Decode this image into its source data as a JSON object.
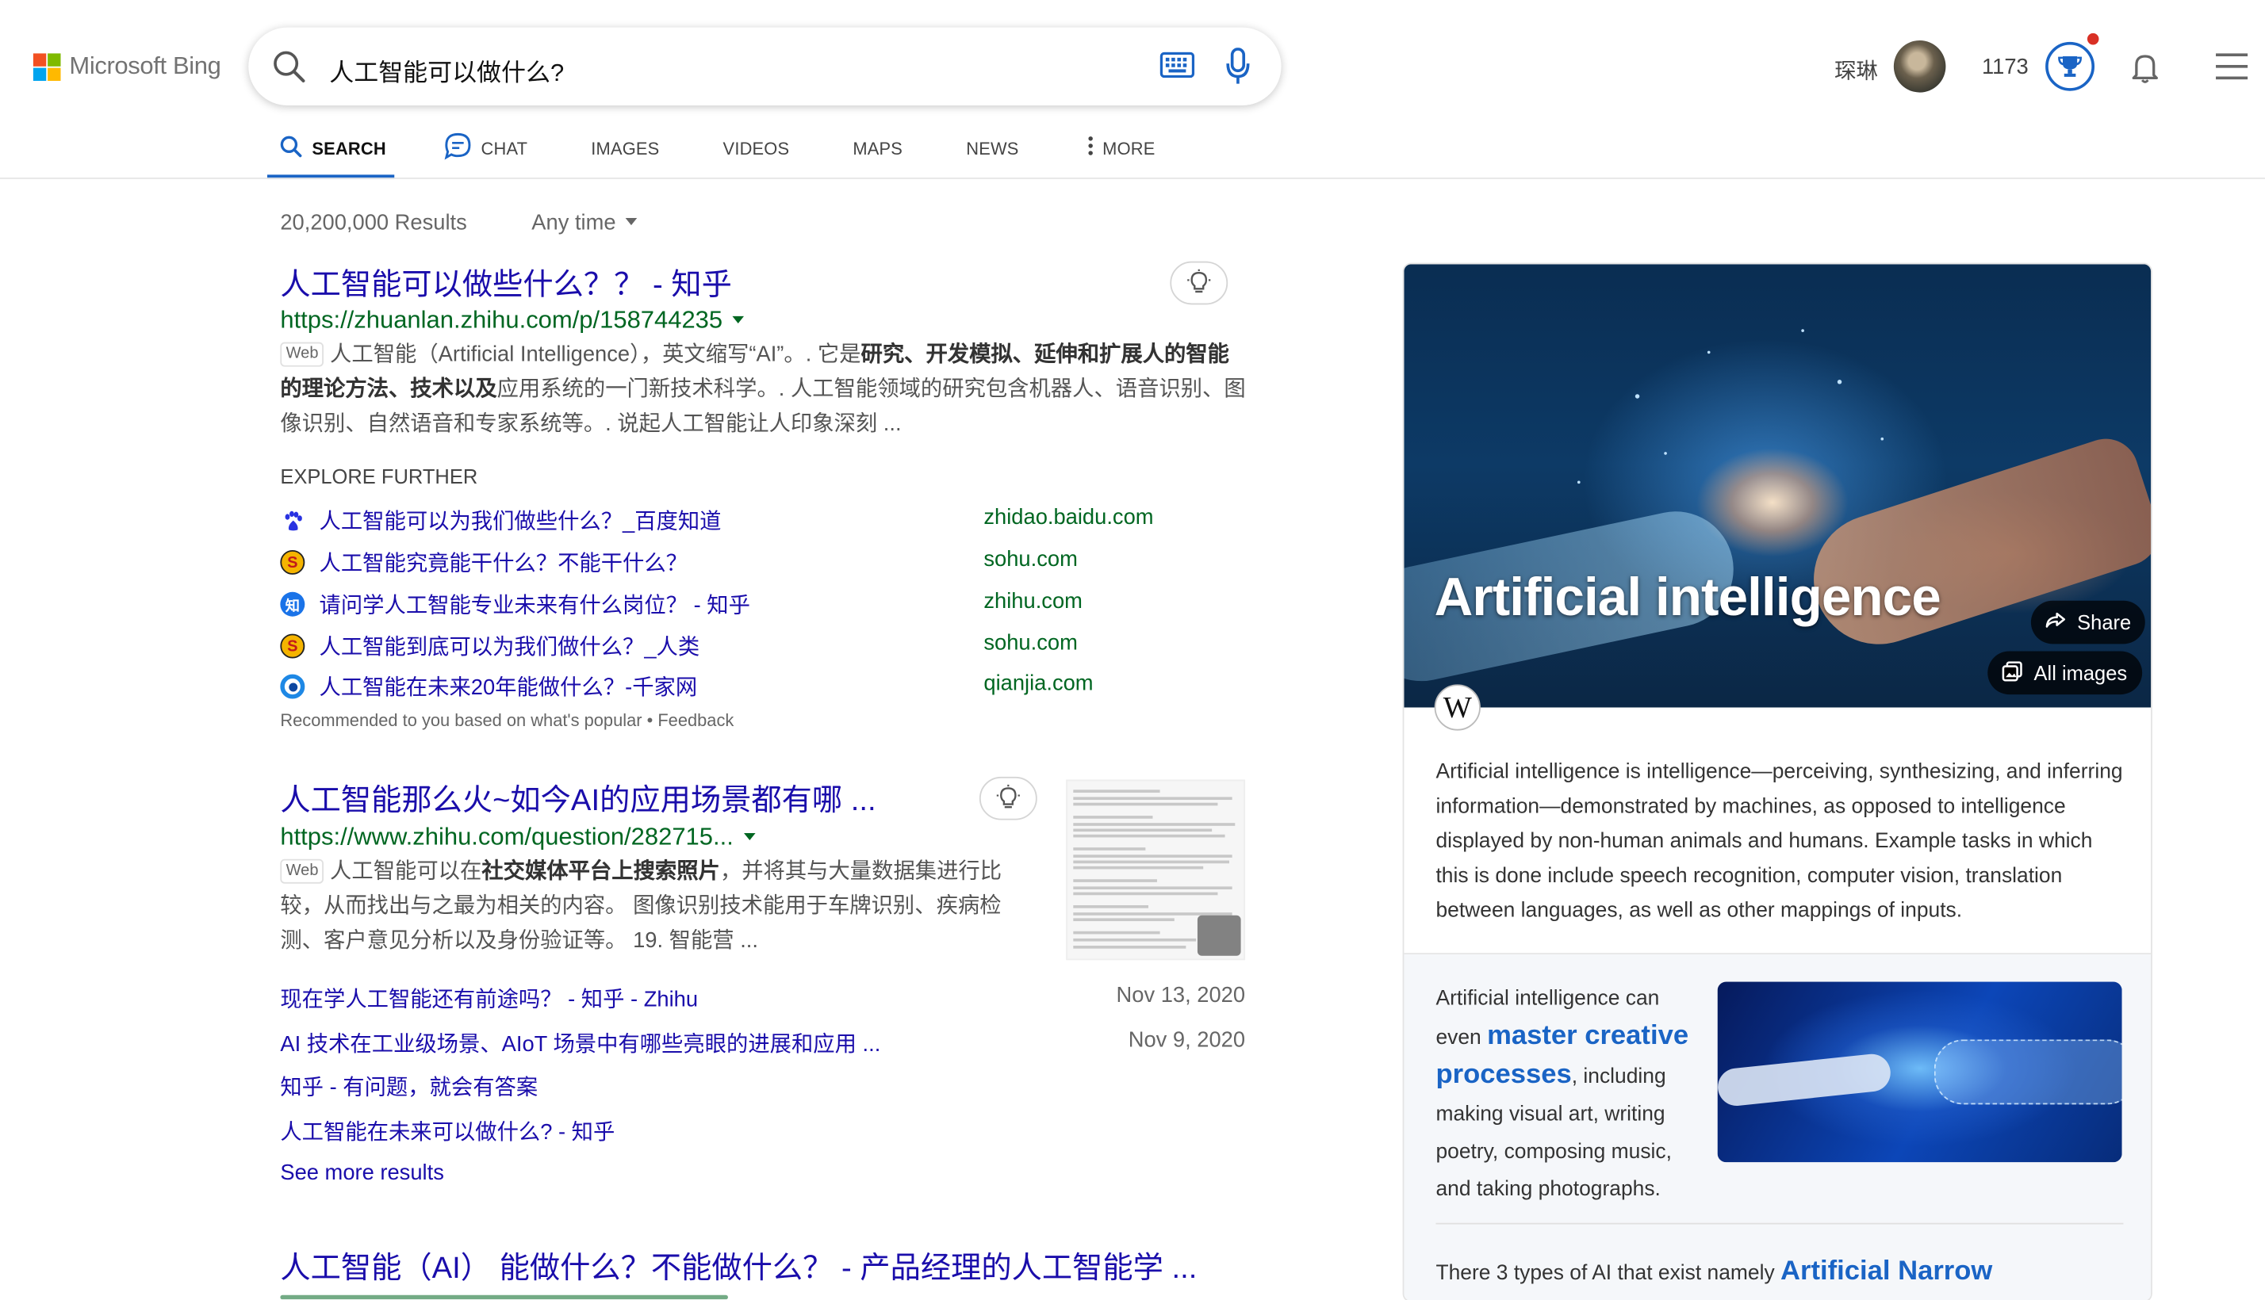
{
  "brand": {
    "name": "Microsoft Bing"
  },
  "search": {
    "query": "人工智能可以做什么?"
  },
  "user": {
    "name": "琛琳",
    "points": "1173"
  },
  "tabs": [
    {
      "label": "SEARCH"
    },
    {
      "label": "CHAT"
    },
    {
      "label": "IMAGES"
    },
    {
      "label": "VIDEOS"
    },
    {
      "label": "MAPS"
    },
    {
      "label": "NEWS"
    },
    {
      "label": "MORE"
    }
  ],
  "results_meta": {
    "count": "20,200,000 Results",
    "time_filter": "Any time"
  },
  "results": [
    {
      "title": "人工智能可以做些什么？？ - 知乎",
      "url": "https://zhuanlan.zhihu.com/p/158744235",
      "tag": "Web",
      "snippet_parts": [
        "人工智能（Artificial Intelligence），英文缩写“AI”。. 它是",
        "研究、开发模拟、延伸和扩展人的智能的理论方法、技术以及",
        "应用系统的一门新技术科学。. 人工智能领域的研究包含机器人、语音识别、图像识别、自然语音和专家系统等。. 说起人工智能让人印象深刻 ..."
      ]
    },
    {
      "title": "人工智能那么火~如今AI的应用场景都有哪 ...",
      "url": "https://www.zhihu.com/question/282715...",
      "tag": "Web",
      "snippet_parts": [
        "人工智能可以在",
        "社交媒体平台上搜索照片",
        "，并将其与大量数据集进行比较，从而找出与之最为相关的内容。 图像识别技术能用于车牌识别、疾病检测、客户意见分析以及身份验证等。 19. 智能营 ..."
      ]
    },
    {
      "title": "人工智能（AI） 能做什么？不能做什么？ - 产品经理的人工智能学 ..."
    }
  ],
  "explore": {
    "heading": "EXPLORE FURTHER",
    "items": [
      {
        "text": "人工智能可以为我们做些什么？_百度知道",
        "domain": "zhidao.baidu.com",
        "icon": "baidu-icon",
        "color": "#2932e1"
      },
      {
        "text": "人工智能究竟能干什么？不能干什么？",
        "domain": "sohu.com",
        "icon": "sohu-icon",
        "color": "#e9a400"
      },
      {
        "text": "请问学人工智能专业未来有什么岗位？ - 知乎",
        "domain": "zhihu.com",
        "icon": "zhihu-icon",
        "color": "#1a73e8"
      },
      {
        "text": "人工智能到底可以为我们做什么？_人类",
        "domain": "sohu.com",
        "icon": "sohu-icon",
        "color": "#e9a400"
      },
      {
        "text": "人工智能在未来20年能做什么？-千家网",
        "domain": "qianjia.com",
        "icon": "qianjia-icon",
        "color": "#1e88e5"
      }
    ],
    "recommend": "Recommended to you based on what's popular • Feedback"
  },
  "sublinks": [
    {
      "text": "现在学人工智能还有前途吗？ - 知乎 - Zhihu",
      "date": "Nov 13, 2020"
    },
    {
      "text": "AI 技术在工业级场景、AIoT 场景中有哪些亮眼的进展和应用 ...",
      "date": "Nov 9, 2020"
    },
    {
      "text": "知乎 - 有问题，就会有答案",
      "date": ""
    },
    {
      "text": "人工智能在未来可以做什么? - 知乎",
      "date": ""
    }
  ],
  "see_more": "See more results",
  "knowledge_panel": {
    "title": "Artificial intelligence",
    "share_label": "Share",
    "all_images_label": "All images",
    "source_icon": "W",
    "description": "Artificial intelligence is intelligence—perceiving, synthesizing, and inferring information—demonstrated by machines, as opposed to intelligence displayed by non-human animals and humans. Example tasks in which this is done include speech recognition, computer vision, translation between languages, as well as other mappings of inputs.",
    "fact_pre": "Artificial intelligence can even ",
    "fact_highlight": "master creative processes",
    "fact_post": ", including making visual art, writing poetry, composing music, and taking photographs.",
    "types_pre": "There 3 types of AI that exist namely ",
    "types_highlight": "Artificial Narrow"
  },
  "colors": {
    "link": "#1a0dab",
    "url": "#006621",
    "accent": "#1a64c5"
  }
}
